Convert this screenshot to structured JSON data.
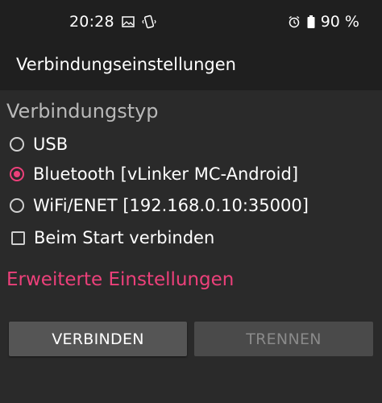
{
  "status_bar": {
    "time": "20:28",
    "left_icons": [
      "image-icon",
      "vibrate-icon"
    ],
    "right_icons": [
      "alarm-icon",
      "battery-icon"
    ],
    "battery": "90 %"
  },
  "toolbar": {
    "title": "Verbindungseinstellungen"
  },
  "connection": {
    "section_title": "Verbindungstyp",
    "options": [
      {
        "label": "USB",
        "selected": false
      },
      {
        "label": "Bluetooth [vLinker MC-Android]",
        "selected": true
      },
      {
        "label": "WiFi/ENET [192.168.0.10:35000]",
        "selected": false
      }
    ],
    "autoconnect": {
      "label": "Beim Start verbinden",
      "checked": false
    }
  },
  "advanced_link": "Erweiterte Einstellungen",
  "buttons": {
    "connect": "VERBINDEN",
    "disconnect": "TRENNEN"
  },
  "colors": {
    "accent": "#ec407a",
    "background": "#2a2a2a",
    "bar": "#1f1f1f"
  }
}
